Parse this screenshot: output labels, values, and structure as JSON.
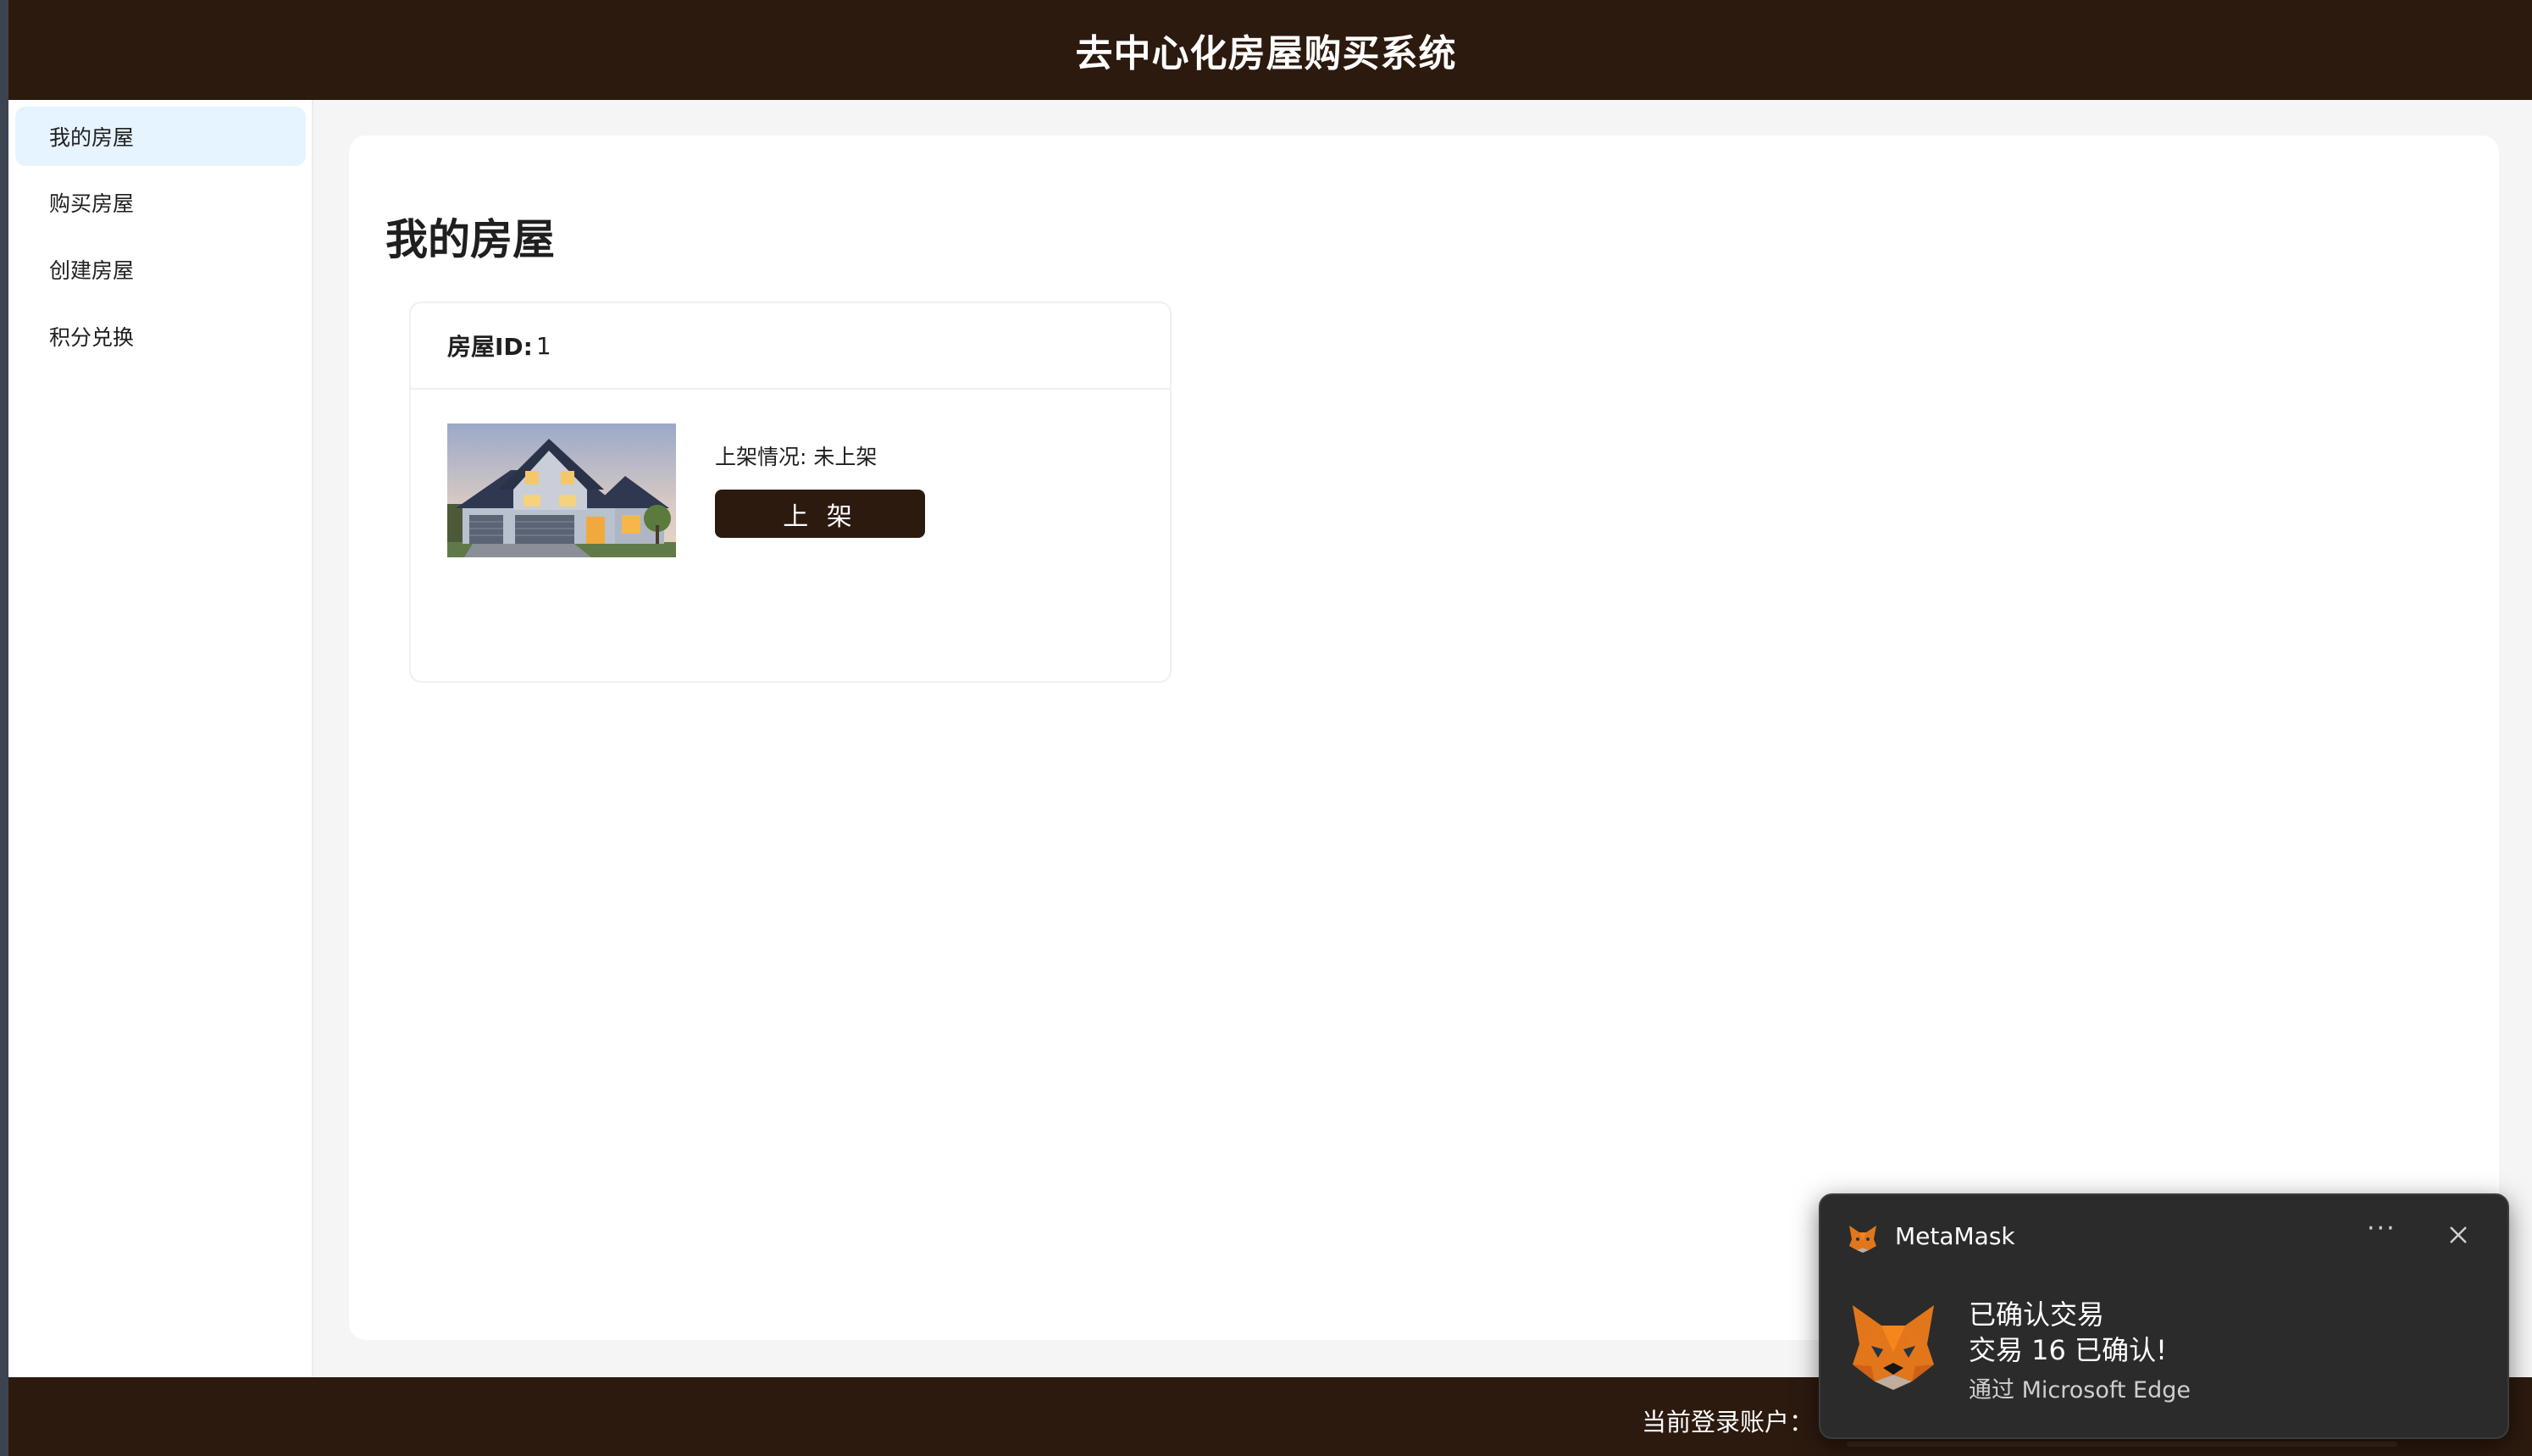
{
  "header": {
    "title": "去中心化房屋购买系统"
  },
  "sidebar": {
    "items": [
      {
        "label": "我的房屋",
        "active": true
      },
      {
        "label": "购买房屋",
        "active": false
      },
      {
        "label": "创建房屋",
        "active": false
      },
      {
        "label": "积分兑换",
        "active": false
      }
    ]
  },
  "main": {
    "page_title": "我的房屋",
    "card": {
      "id_label": "房屋ID:",
      "id_value": "1",
      "status_text": "上架情况: 未上架",
      "list_button": "上 架"
    }
  },
  "footer": {
    "account_label": "当前登录账户："
  },
  "toast": {
    "app_name": "MetaMask",
    "more_icon": "···",
    "title": "已确认交易",
    "body": "交易 16 已确认!",
    "source": "通过 Microsoft Edge"
  },
  "colors": {
    "brand_dark": "#2c1a0f",
    "menu_active_bg": "#e6f4ff",
    "toast_bg": "#2b2b2b"
  }
}
